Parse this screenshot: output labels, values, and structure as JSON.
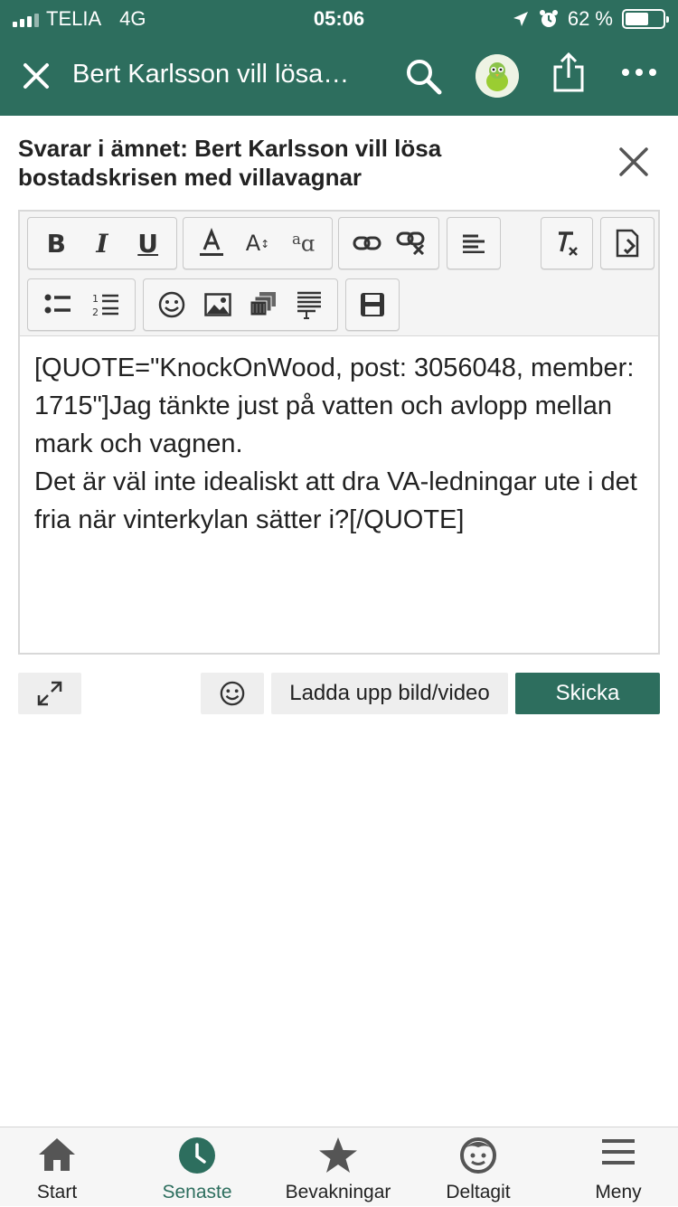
{
  "status_bar": {
    "carrier": "TELIA",
    "network": "4G",
    "time": "05:06",
    "battery_text": "62 %",
    "battery_level": 0.62
  },
  "app_bar": {
    "title": "Bert Karlsson vill lösa…",
    "icons": [
      "close-icon",
      "search-icon",
      "avatar",
      "share-icon",
      "more-icon"
    ]
  },
  "reply": {
    "header": "Svarar i ämnet: Bert Karlsson vill lösa bostadskrisen med villavagnar"
  },
  "editor": {
    "toolbar": {
      "bold_label": "B",
      "italic_label": "I",
      "underline_label": "U",
      "font_size_label": "A",
      "font_size_sup": "↕",
      "font_family_label": "a",
      "font_family_sub": "ɑ"
    },
    "content": "[QUOTE=\"KnockOnWood, post: 3056048, member: 1715\"]Jag tänkte just på vatten och avlopp mellan mark och vagnen.\nDet är väl inte idealiskt att dra VA-ledningar ute i det fria när vinterkylan sätter i?[/QUOTE]"
  },
  "actions": {
    "upload_label": "Ladda upp bild/video",
    "send_label": "Skicka"
  },
  "tabbar": {
    "items": [
      {
        "label": "Start",
        "icon": "home-icon"
      },
      {
        "label": "Senaste",
        "icon": "clock-icon"
      },
      {
        "label": "Bevakningar",
        "icon": "star-icon"
      },
      {
        "label": "Deltagit",
        "icon": "face-icon"
      },
      {
        "label": "Meny",
        "icon": "menu-icon"
      }
    ],
    "active": "Senaste"
  },
  "colors": {
    "brand": "#2d6e5e"
  }
}
